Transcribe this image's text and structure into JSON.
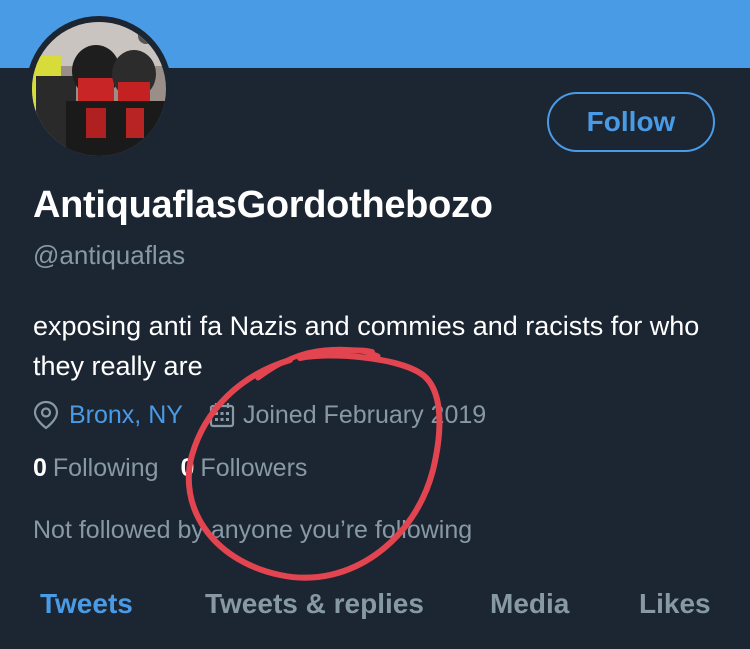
{
  "profile": {
    "display_name": "AntiquaflasGordothebozo",
    "handle": "@antiquaflas",
    "bio": "exposing anti fa Nazis and commies and racists for who they really are",
    "location": "Bronx, NY",
    "joined": "Joined February 2019",
    "following_count": "0",
    "following_label": "Following",
    "followers_count": "0",
    "followers_label": "Followers",
    "not_followed_text": "Not followed by anyone you’re following"
  },
  "actions": {
    "follow_label": "Follow"
  },
  "tabs": [
    {
      "label": "Tweets",
      "active": true
    },
    {
      "label": "Tweets & replies",
      "active": false
    },
    {
      "label": "Media",
      "active": false
    },
    {
      "label": "Likes",
      "active": false
    }
  ],
  "icons": {
    "location": "location-pin-icon",
    "calendar": "calendar-icon"
  },
  "colors": {
    "background": "#1c2532",
    "accent": "#4a9be6",
    "secondary_text": "#8899a6",
    "annotation": "#e2454f"
  }
}
